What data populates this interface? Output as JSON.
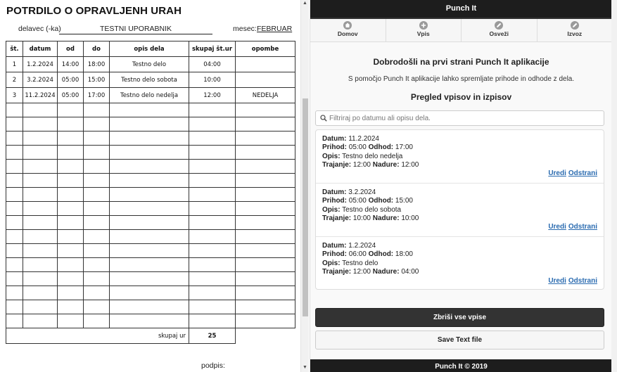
{
  "left": {
    "title": "POTRDILO O OPRAVLJENH URAH",
    "worker_label": "delavec (-ka)",
    "worker_name": "TESTNI UPORABNIK",
    "month_label": "mesec:",
    "month_value": "FEBRUAR",
    "table": {
      "headers": [
        "št.",
        "datum",
        "od",
        "do",
        "opis dela",
        "skupaj št.ur",
        "opombe"
      ],
      "rows": [
        [
          "1",
          "1.2.2024",
          "14:00",
          "18:00",
          "Testno delo",
          "04:00",
          ""
        ],
        [
          "2",
          "3.2.2024",
          "05:00",
          "15:00",
          "Testno delo sobota",
          "10:00",
          ""
        ],
        [
          "3",
          "11.2.2024",
          "05:00",
          "17:00",
          "Testno delo nedelja",
          "12:00",
          "NEDELJA"
        ]
      ],
      "empty_rows": 16,
      "sum_label": "skupaj ur",
      "sum_value": "25"
    },
    "signature_label": "podpis:"
  },
  "app": {
    "title": "Punch It",
    "nav": [
      {
        "label": "Domov",
        "icon": "home-icon"
      },
      {
        "label": "Vpis",
        "icon": "plus-icon"
      },
      {
        "label": "Osveži",
        "icon": "edit-icon"
      },
      {
        "label": "Izvoz",
        "icon": "edit-icon"
      }
    ],
    "welcome": "Dobrodošli na prvi strani Punch It aplikacije",
    "intro": "S pomočjo Punch It aplikacije lahko spremljate prihode in odhode z dela.",
    "overview_title": "Pregled vpisov in izpisov",
    "filter_placeholder": "Filtriraj po datumu ali opisu dela.",
    "labels": {
      "date": "Datum:",
      "arrival": "Prihod:",
      "departure": "Odhod:",
      "description": "Opis:",
      "duration": "Trajanje:",
      "overtime": "Nadure:",
      "edit": "Uredi",
      "delete": "Odstrani"
    },
    "entries": [
      {
        "date": "11.2.2024",
        "arrival": "05:00",
        "departure": "17:00",
        "description": "Testno delo nedelja",
        "duration": "12:00",
        "overtime": "12:00"
      },
      {
        "date": "3.2.2024",
        "arrival": "05:00",
        "departure": "15:00",
        "description": "Testno delo sobota",
        "duration": "10:00",
        "overtime": "10:00"
      },
      {
        "date": "1.2.2024",
        "arrival": "06:00",
        "departure": "18:00",
        "description": "Testno delo",
        "duration": "12:00",
        "overtime": "04:00"
      }
    ],
    "delete_all_label": "Zbriši vse vpise",
    "save_label": "Save Text file",
    "footer": "Punch It © 2019"
  }
}
